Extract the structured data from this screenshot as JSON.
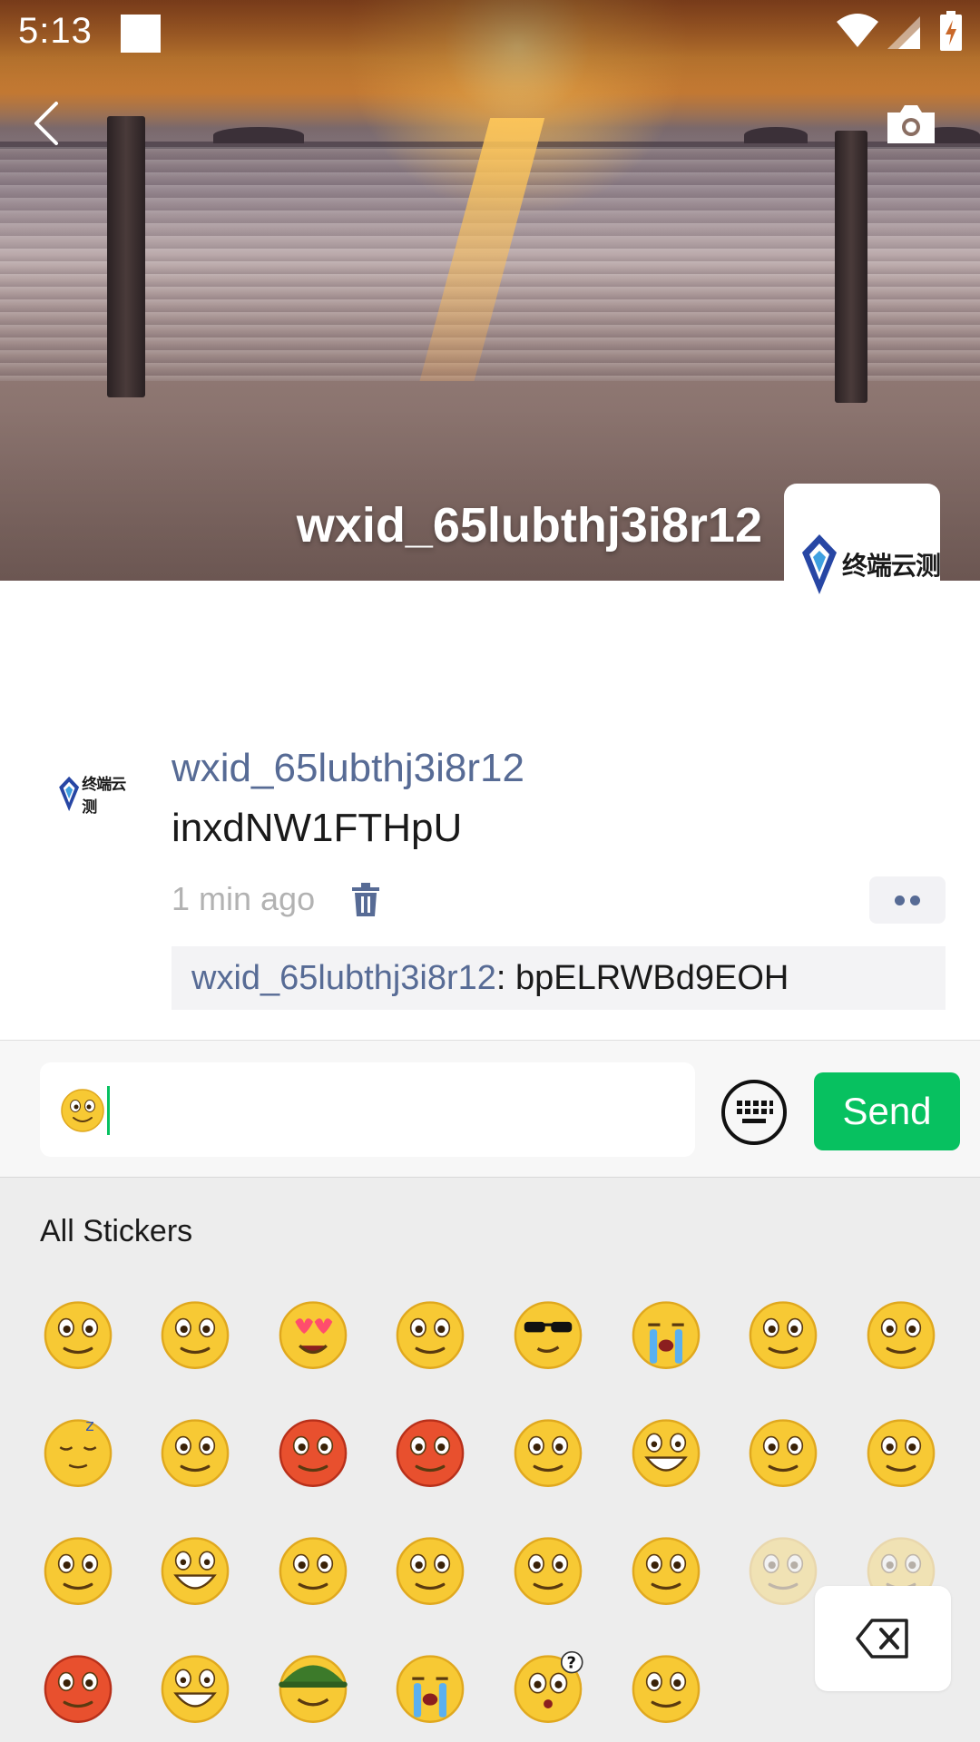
{
  "status_bar": {
    "time": "5:13"
  },
  "profile": {
    "name": "wxid_65lubthj3i8r12",
    "logo_text": "终端云测"
  },
  "post": {
    "author": "wxid_65lubthj3i8r12",
    "text": "inxdNW1FTHpU",
    "time": "1 min ago",
    "comment": {
      "user": "wxid_65lubthj3i8r12",
      "separator": ": ",
      "text": "bpELRWBd9EOH"
    }
  },
  "composer": {
    "value_emoji": "smile",
    "send_label": "Send"
  },
  "sticker_panel": {
    "title": "All Stickers",
    "stickers": [
      "smile",
      "awkward",
      "heart-eyes",
      "stare",
      "cool",
      "cry",
      "shy",
      "silent",
      "sleep",
      "sob",
      "embarrassed",
      "angry",
      "tongue",
      "grin",
      "surprise",
      "frown",
      "blush",
      "laugh",
      "sweat",
      "pick-nose",
      "happy",
      "wow",
      "dull",
      "bored",
      "scared",
      "chuckle",
      "soldier",
      "tears",
      "question",
      "shush"
    ]
  },
  "colors": {
    "accent_green": "#07c160",
    "link_blue": "#576b95",
    "emoji_yellow": "#f7c934"
  }
}
